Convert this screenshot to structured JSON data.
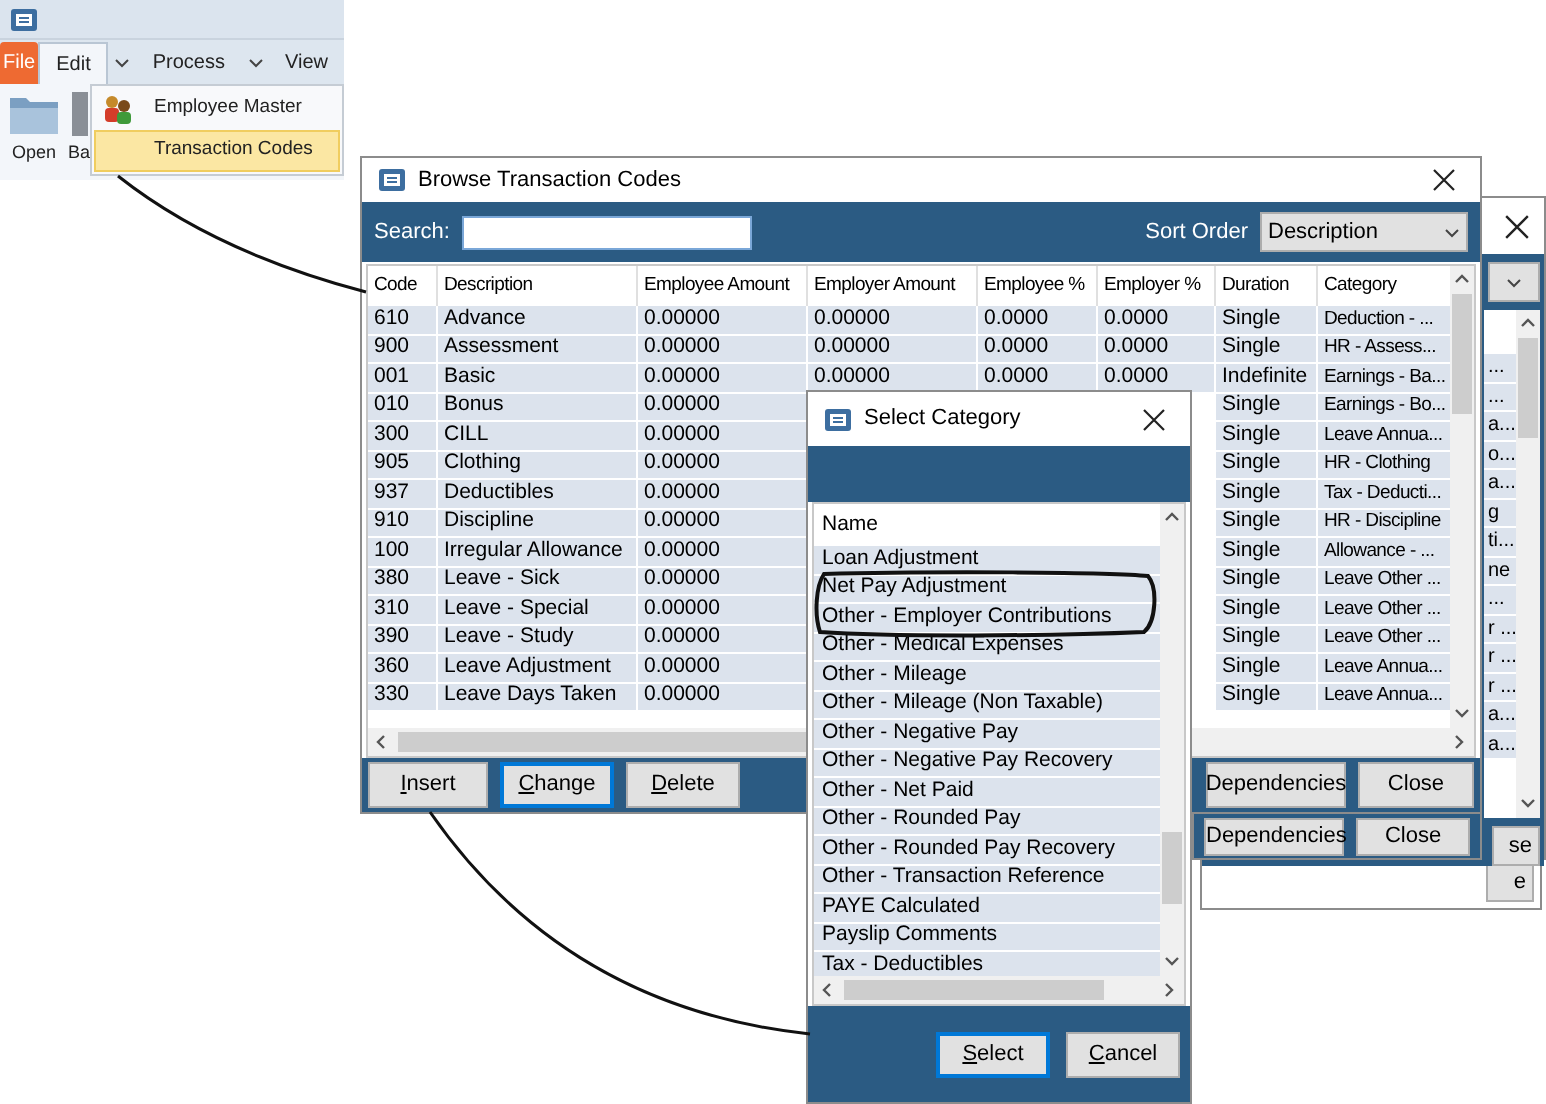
{
  "ribbon": {
    "tabs": [
      {
        "label": "File",
        "kind": "file",
        "selected": false
      },
      {
        "label": "Edit",
        "kind": "split",
        "selected": true
      },
      {
        "label": "Process",
        "kind": "split",
        "selected": false
      },
      {
        "label": "View",
        "kind": "plain",
        "selected": false
      }
    ],
    "buttons": [
      {
        "label": "Open",
        "kind": "folder"
      },
      {
        "label": "Ba",
        "kind": "cut"
      }
    ],
    "menu": [
      {
        "label": "Employee Master",
        "kind": "icon",
        "selected": false
      },
      {
        "label": "Transaction Codes",
        "kind": "plain",
        "selected": true
      }
    ]
  },
  "back_window": {
    "column_fragments": [
      "...",
      "...",
      "a...",
      "o...",
      "a...",
      "g",
      "ti...",
      "ne",
      "...",
      "r ...",
      "r ...",
      "r ...",
      "a...",
      "a..."
    ],
    "buttons": [
      "se"
    ]
  },
  "far_window": {
    "buttons": [
      "e"
    ]
  },
  "middle_window": {
    "buttons": [
      "Dependencies",
      "Close"
    ]
  },
  "browse_window": {
    "title": "Browse Transaction Codes",
    "search_label": "Search:",
    "sort_label": "Sort Order",
    "sort_value": "Description",
    "columns": [
      "Code",
      "Description",
      "Employee Amount",
      "Employer Amount",
      "Employee %",
      "Employer %",
      "Duration",
      "Category"
    ],
    "rows": [
      [
        "610",
        "Advance",
        "0.00000",
        "0.00000",
        "0.0000",
        "0.0000",
        "Single",
        "Deduction - ..."
      ],
      [
        "900",
        "Assessment",
        "0.00000",
        "0.00000",
        "0.0000",
        "0.0000",
        "Single",
        "HR - Assess..."
      ],
      [
        "001",
        "Basic",
        "0.00000",
        "0.00000",
        "0.0000",
        "0.0000",
        "Indefinite",
        "Earnings - Ba..."
      ],
      [
        "010",
        "Bonus",
        "0.00000",
        null,
        null,
        null,
        "Single",
        "Earnings - Bo..."
      ],
      [
        "300",
        "CILL",
        "0.00000",
        null,
        null,
        null,
        "Single",
        "Leave Annua..."
      ],
      [
        "905",
        "Clothing",
        "0.00000",
        null,
        null,
        null,
        "Single",
        "HR - Clothing"
      ],
      [
        "937",
        "Deductibles",
        "0.00000",
        null,
        null,
        null,
        "Single",
        "Tax - Deducti..."
      ],
      [
        "910",
        "Discipline",
        "0.00000",
        null,
        null,
        null,
        "Single",
        "HR - Discipline"
      ],
      [
        "100",
        "Irregular Allowance",
        "0.00000",
        null,
        null,
        null,
        "Single",
        "Allowance - ..."
      ],
      [
        "380",
        "Leave - Sick",
        "0.00000",
        null,
        null,
        null,
        "Single",
        "Leave Other ..."
      ],
      [
        "310",
        "Leave - Special",
        "0.00000",
        null,
        null,
        null,
        "Single",
        "Leave Other ..."
      ],
      [
        "390",
        "Leave - Study",
        "0.00000",
        null,
        null,
        null,
        "Single",
        "Leave Other ..."
      ],
      [
        "360",
        "Leave Adjustment",
        "0.00000",
        null,
        null,
        null,
        "Single",
        "Leave Annua..."
      ],
      [
        "330",
        "Leave Days Taken",
        "0.00000",
        null,
        null,
        null,
        "Single",
        "Leave Annua..."
      ]
    ],
    "buttons_left": [
      {
        "label": "Insert",
        "access_key": true,
        "default": false
      },
      {
        "label": "Change",
        "access_key": true,
        "default": true
      },
      {
        "label": "Delete",
        "access_key": true,
        "default": false
      }
    ],
    "buttons_right": [
      {
        "label": "Dependencies",
        "access_key": false,
        "default": false
      },
      {
        "label": "Close",
        "access_key": false,
        "default": false
      }
    ]
  },
  "select_category": {
    "title": "Select Category",
    "column": "Name",
    "items": [
      "Loan Adjustment",
      "Net Pay Adjustment",
      "Other - Employer Contributions",
      "Other - Medical Expenses",
      "Other - Mileage",
      "Other - Mileage (Non Taxable)",
      "Other - Negative Pay",
      "Other - Negative Pay Recovery",
      "Other - Net Paid",
      "Other - Rounded Pay",
      "Other - Rounded Pay Recovery",
      "Other - Transaction Reference",
      "PAYE Calculated",
      "Payslip Comments",
      "Tax - Deductibles"
    ],
    "buttons": [
      {
        "label": "Select",
        "access_key": true,
        "default": true
      },
      {
        "label": "Cancel",
        "access_key": true,
        "default": false
      }
    ]
  }
}
